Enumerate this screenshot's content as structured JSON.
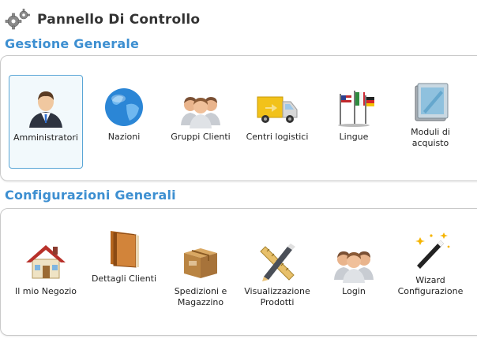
{
  "header": {
    "title": "Pannello Di Controllo",
    "icon": "gears-icon"
  },
  "sections": [
    {
      "title": "Gestione Generale",
      "items": [
        {
          "label": "Amministratori",
          "icon": "administrator-icon",
          "selected": true
        },
        {
          "label": "Nazioni",
          "icon": "globe-icon"
        },
        {
          "label": "Gruppi Clienti",
          "icon": "user-group-icon"
        },
        {
          "label": "Centri logistici",
          "icon": "truck-icon"
        },
        {
          "label": "Lingue",
          "icon": "flags-icon"
        },
        {
          "label": "Moduli di acquisto",
          "icon": "forms-icon"
        }
      ]
    },
    {
      "title": "Configurazioni Generali",
      "items": [
        {
          "label": "Il mio Negozio",
          "icon": "house-icon"
        },
        {
          "label": "Dettagli Clienti",
          "icon": "book-icon"
        },
        {
          "label": "Spedizioni e Magazzino",
          "icon": "box-icon"
        },
        {
          "label": "Visualizzazione Prodotti",
          "icon": "pencil-ruler-icon"
        },
        {
          "label": "Login",
          "icon": "users-login-icon"
        },
        {
          "label": "Wizard Configurazione",
          "icon": "magic-wand-icon"
        }
      ]
    }
  ],
  "colors": {
    "section_title": "#3d8fd1",
    "selected_border": "#5aa6d6",
    "selected_bg": "#f2f9fc"
  }
}
